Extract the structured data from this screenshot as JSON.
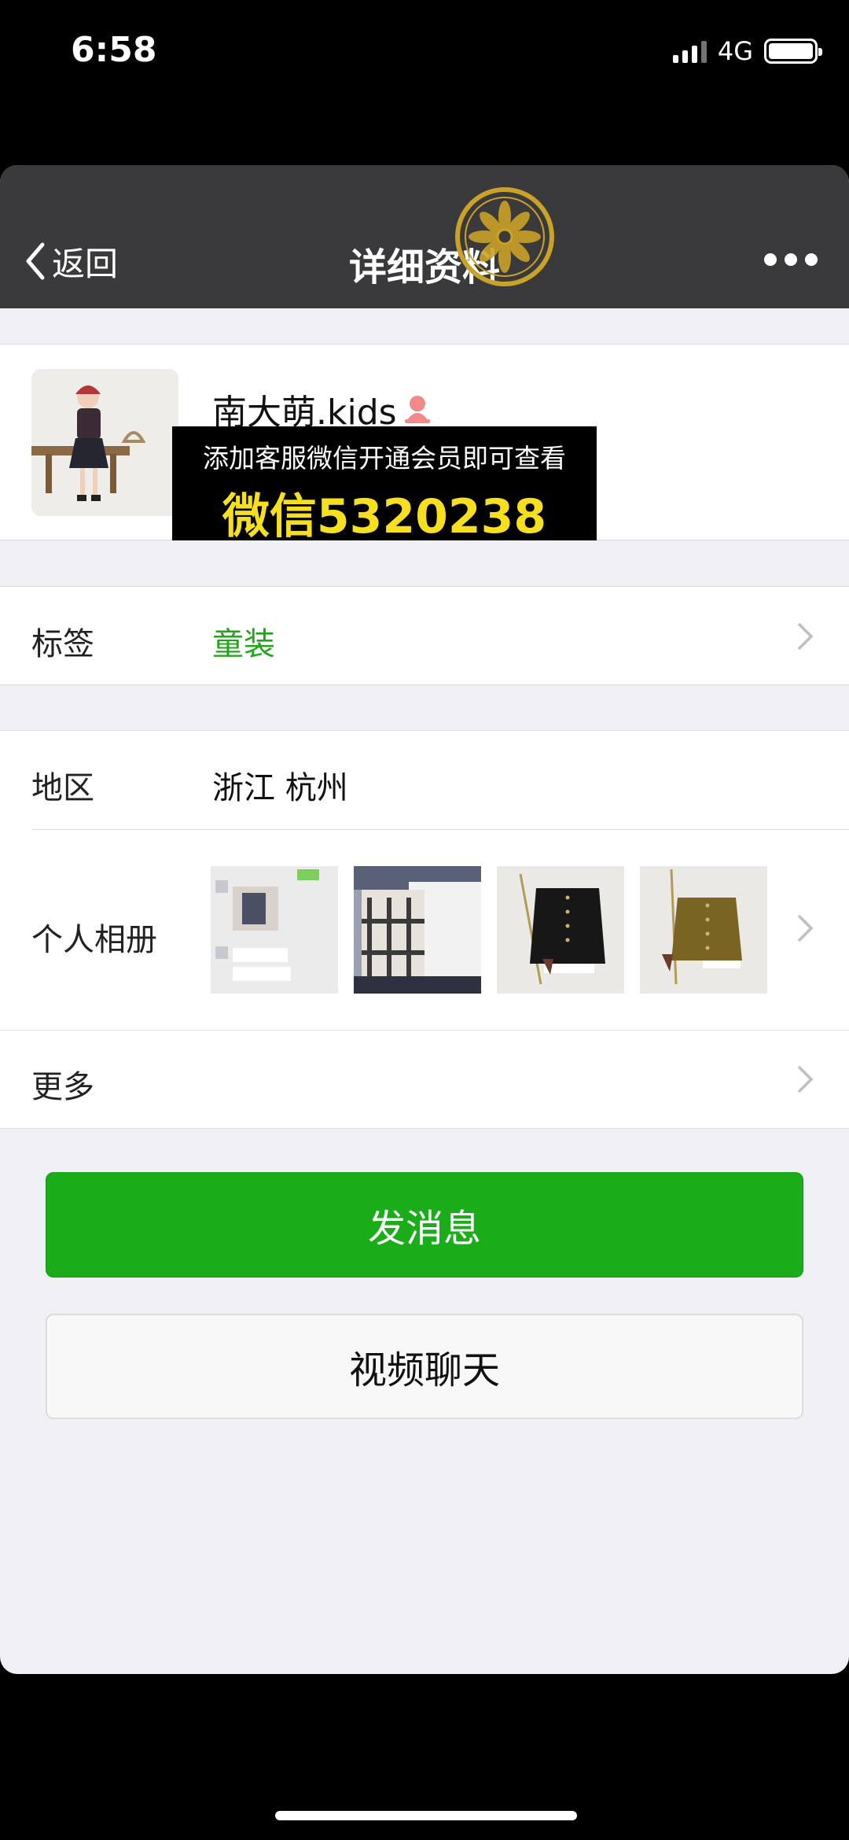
{
  "status_bar": {
    "time": "6:58",
    "network": "4G",
    "battery_level": 1.0
  },
  "nav": {
    "back_label": "返回",
    "title": "详细资料",
    "more_icon": "more-dots-icon"
  },
  "profile": {
    "name": "南大萌.kids",
    "gender_icon": "female-icon"
  },
  "overlay": {
    "line1": "添加客服微信开通会员即可查看",
    "line2": "微信5320238"
  },
  "tag": {
    "label": "标签",
    "value": "童装"
  },
  "region": {
    "label": "地区",
    "value": "浙江  杭州"
  },
  "album": {
    "label": "个人相册"
  },
  "more": {
    "label": "更多"
  },
  "actions": {
    "send_message": "发消息",
    "video_call": "视频聊天"
  },
  "colors": {
    "accent_green": "#1aad19",
    "nav_bg": "#3a3a3c",
    "overlay_text": "#f5df1f"
  }
}
